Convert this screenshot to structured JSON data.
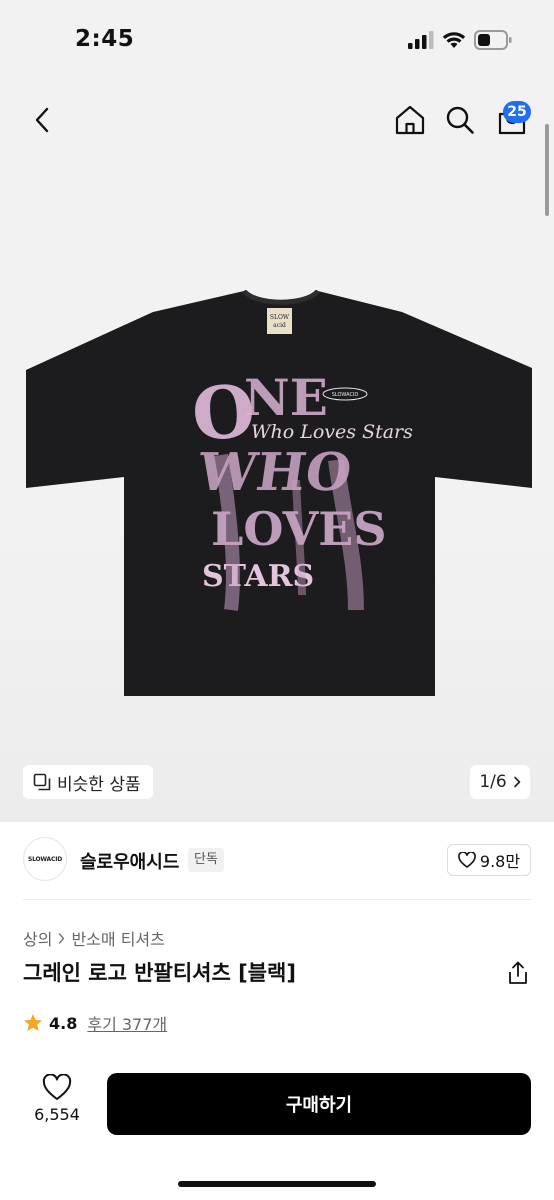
{
  "status_bar": {
    "time": "2:45"
  },
  "nav": {
    "cart_count": "25",
    "icons": [
      "chevron-left-icon",
      "home-icon",
      "search-icon",
      "shopping-bag-icon"
    ]
  },
  "gallery": {
    "similar_label": "비슷한 상품",
    "page_counter": "1/6",
    "product_image": {
      "description_icon": "black-tshirt-image",
      "garment_color": "#1c1c1e",
      "print_color": "#d9b3d4",
      "print_text": [
        "ONE",
        "Who Loves Stars",
        "WHO",
        "LOVES",
        "STARS"
      ],
      "neck_label": "SLOW acid",
      "chest_logo": "SLOWACID"
    }
  },
  "brand": {
    "logo_text": "SLOWACID",
    "name": "슬로우애시드",
    "exclusive_label": "단독",
    "likes": "9.8만"
  },
  "product": {
    "breadcrumb": [
      "상의",
      "반소매 티셔츠"
    ],
    "title": "그레인 로고 반팔티셔츠 [블랙]",
    "rating": "4.8",
    "review_label": "후기 377개"
  },
  "bottom_bar": {
    "like_count": "6,554",
    "buy_label": "구매하기"
  },
  "colors": {
    "accent_badge": "#1f6ef3",
    "star": "#f5a623",
    "buy_button": "#000000"
  }
}
